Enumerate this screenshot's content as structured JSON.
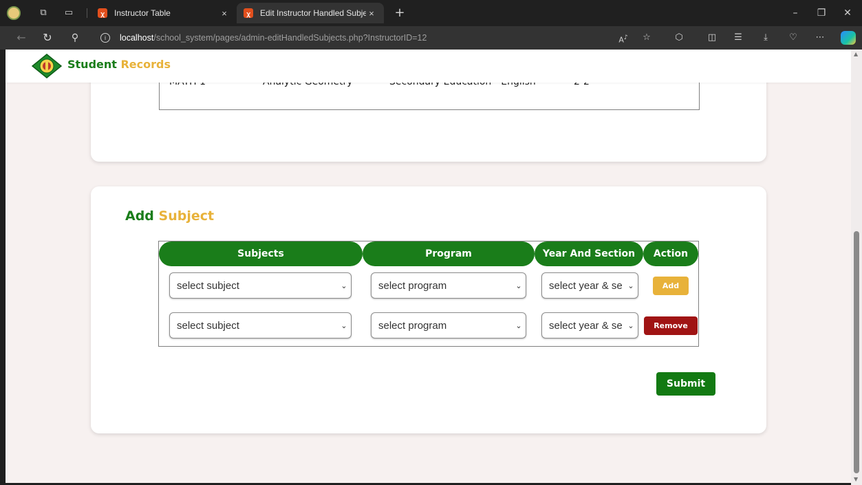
{
  "browser": {
    "tabs": [
      {
        "label": "Instructor Table",
        "active": false
      },
      {
        "label": "Edit Instructor Handled Subjects",
        "active": true
      }
    ],
    "close_glyph": "×",
    "new_tab_glyph": "+",
    "window_controls": [
      "–",
      "❐",
      "✕"
    ],
    "url": {
      "host": "localhost",
      "path": "/school_system/pages/admin-editHandledSubjects.php?InstructorID=12"
    },
    "toolbar_icons": [
      "read-aloud-icon",
      "favorite-icon",
      "extensions-icon",
      "split-screen-icon",
      "favorites-list-icon",
      "downloads-icon",
      "browser-essentials-icon",
      "more-icon",
      "copilot-icon"
    ]
  },
  "site": {
    "brand_first": "Student",
    "brand_second": "Records"
  },
  "handled_subjects": {
    "rows": [
      {
        "code": "MATH 1",
        "subject": "Analytic Geometry",
        "program": "Secondary Education - English",
        "year_section": "2-2"
      }
    ]
  },
  "add_subject": {
    "title_first": "Add",
    "title_second": "Subject",
    "headers": [
      "Subjects",
      "Program",
      "Year And Section",
      "Action"
    ],
    "rows": [
      {
        "subject": "select subject",
        "program": "select program",
        "year_section": "select year & se",
        "action": "Add"
      },
      {
        "subject": "select subject",
        "program": "select program",
        "year_section": "select year & se",
        "action": "Remove"
      }
    ],
    "submit_label": "Submit"
  },
  "colors": {
    "brand_green": "#1a7d1a",
    "brand_yellow": "#e8b23a",
    "remove_red": "#a01414",
    "page_bg": "#f7f1f0"
  }
}
